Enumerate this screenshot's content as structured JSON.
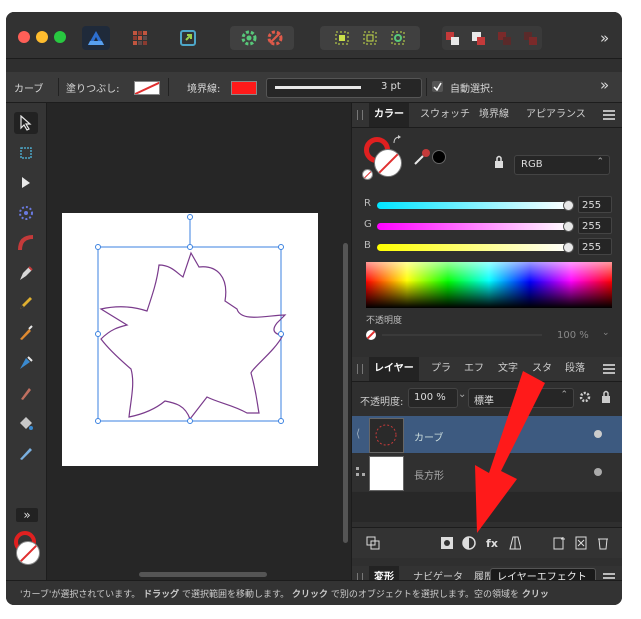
{
  "context_bar": {
    "tool_name": "カーブ",
    "fill_label": "塗りつぶし:",
    "stroke_label": "境界線:",
    "stroke_color": "#ff1a1a",
    "stroke_width": "3 pt",
    "auto_select_label": "自動選択:",
    "more": "»"
  },
  "titlebar": {
    "more": "»"
  },
  "toolbar": {
    "more": "»"
  },
  "color_panel": {
    "tabs": [
      "カラー",
      "スウォッチ",
      "境界線",
      "アピアランス"
    ],
    "model": "RGB",
    "channels": [
      {
        "label": "R",
        "value": "255"
      },
      {
        "label": "G",
        "value": "255"
      },
      {
        "label": "B",
        "value": "255"
      }
    ],
    "opacity_label": "不透明度",
    "opacity_value": "100 %"
  },
  "layers_panel": {
    "tabs": [
      "レイヤー",
      "プラ",
      "エフ",
      "文字",
      "スタ",
      "段落"
    ],
    "opacity_label": "不透明度:",
    "opacity_value": "100 %",
    "blend_mode": "標準",
    "layers": [
      {
        "name": "カーブ",
        "selected": true
      },
      {
        "name": "長方形",
        "selected": false
      }
    ],
    "tooltip": "レイヤーエフェクト"
  },
  "bottom_panel": {
    "tabs": [
      "変形",
      "ナビゲータ",
      "履歴"
    ]
  },
  "status": {
    "parts": [
      {
        "text": "'カーブ'が選択されています。",
        "bold": false
      },
      {
        "text": "ドラッグ",
        "bold": true
      },
      {
        "text": "で選択範囲を移動します。",
        "bold": false
      },
      {
        "text": "クリック",
        "bold": true
      },
      {
        "text": "で別のオブジェクトを選択します。空の領域を",
        "bold": false
      },
      {
        "text": "クリッ",
        "bold": true
      }
    ]
  },
  "colors": {
    "accent": "#3b6ea5",
    "arrow": "#ff1a1a",
    "selected_row": "#3d5a80",
    "flower_stroke": "#7a3b8c"
  }
}
